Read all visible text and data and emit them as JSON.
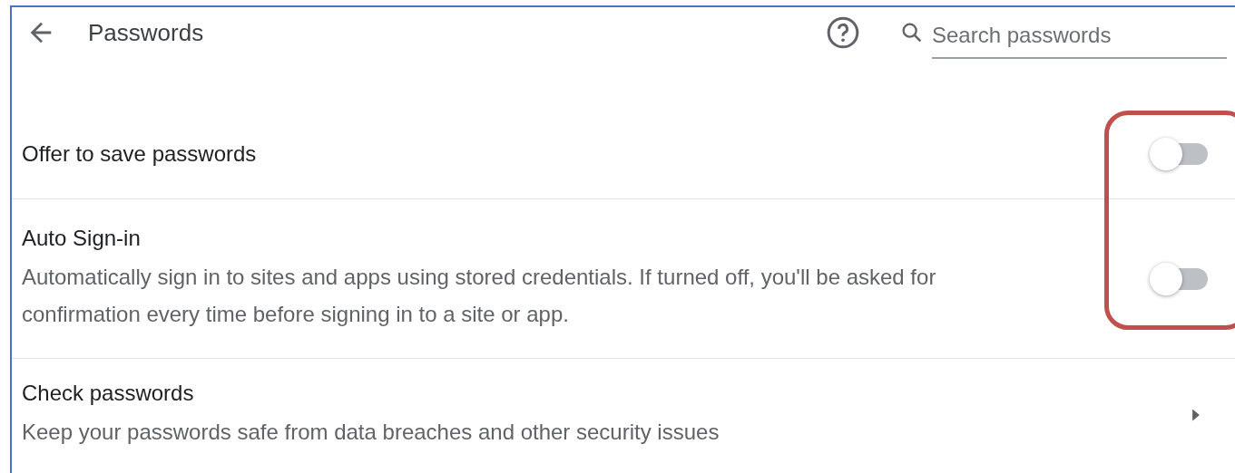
{
  "header": {
    "title": "Passwords",
    "search": {
      "placeholder": "Search passwords"
    }
  },
  "rows": [
    {
      "kind": "toggle",
      "label": "Offer to save passwords",
      "on": false
    },
    {
      "kind": "toggle",
      "label": "Auto Sign-in",
      "description": "Automatically sign in to sites and apps using stored credentials. If turned off, you'll be asked for confirmation every time before signing in to a site or app.",
      "on": false
    },
    {
      "kind": "link",
      "label": "Check passwords",
      "description": "Keep your passwords safe from data breaches and other security issues"
    }
  ]
}
